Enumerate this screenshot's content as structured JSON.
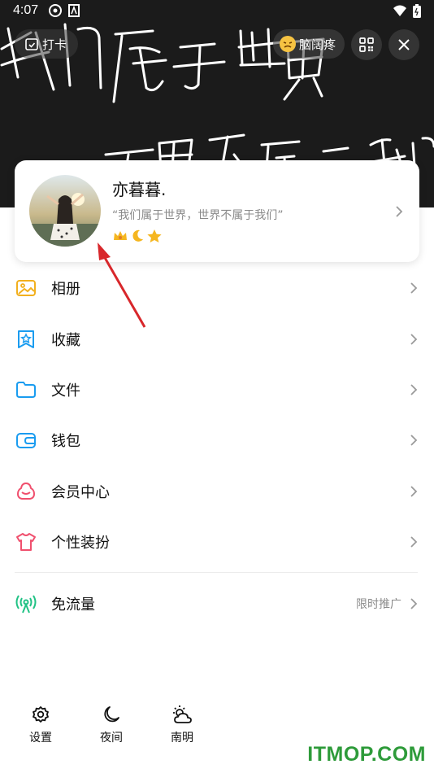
{
  "status_bar": {
    "time": "4:07"
  },
  "header": {
    "checkin_label": "打卡",
    "mood_label": "脑阔疼",
    "handwriting_line1": "我们属于世界",
    "handwriting_line2": "世界不属于我们"
  },
  "profile": {
    "name": "亦暮暮.",
    "signature": "“我们属于世界，世界不属于我们”",
    "badges": [
      "crown-badge-icon",
      "moon-badge-icon",
      "star-badge-icon"
    ]
  },
  "menu": {
    "items": [
      {
        "label": "相册",
        "icon": "photo-album-icon"
      },
      {
        "label": "收藏",
        "icon": "favorites-icon"
      },
      {
        "label": "文件",
        "icon": "folder-icon"
      },
      {
        "label": "钱包",
        "icon": "wallet-icon"
      },
      {
        "label": "会员中心",
        "icon": "vip-icon"
      },
      {
        "label": "个性装扮",
        "icon": "tshirt-icon"
      }
    ],
    "free_data": {
      "label": "免流量",
      "right_text": "限时推广",
      "icon": "signal-icon"
    }
  },
  "bottom": {
    "settings": "设置",
    "night": "夜间",
    "weather": "南明"
  },
  "watermark": "ITMOP.COM",
  "colors": {
    "header_bg": "#1b1b1b",
    "album": "#f2b01e",
    "favorites": "#1a9cf0",
    "folder": "#1a9cf0",
    "wallet": "#1a9cf0",
    "vip": "#f0506e",
    "tshirt": "#f0506e",
    "signal": "#21c285",
    "watermark": "#2e9b3a",
    "arrow": "#d8272b"
  }
}
